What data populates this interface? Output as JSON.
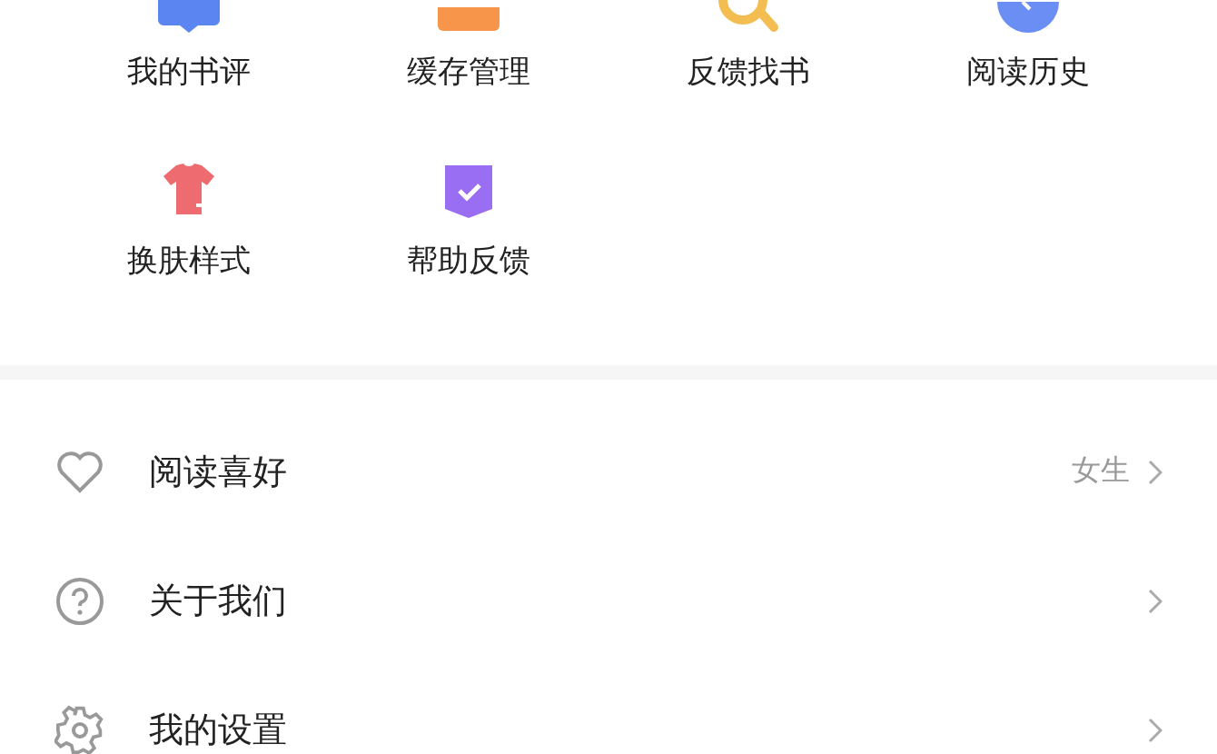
{
  "shortcuts": [
    {
      "label": "我的书评"
    },
    {
      "label": "缓存管理"
    },
    {
      "label": "反馈找书"
    },
    {
      "label": "阅读历史"
    },
    {
      "label": "换肤样式"
    },
    {
      "label": "帮助反馈"
    }
  ],
  "menu": [
    {
      "label": "阅读喜好",
      "value": "女生"
    },
    {
      "label": "关于我们"
    },
    {
      "label": "我的设置"
    }
  ]
}
